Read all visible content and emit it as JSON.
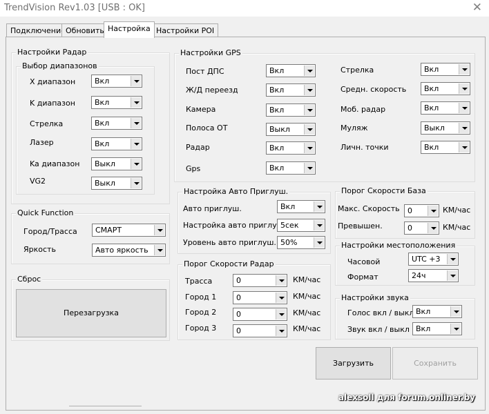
{
  "window": {
    "title": "TrendVision Rev1.03 [USB : OK]",
    "close_glyph": "✕"
  },
  "tabs": [
    {
      "label": "Подключение"
    },
    {
      "label": "Обновить"
    },
    {
      "label": "Настройка"
    },
    {
      "label": "Настройки POI"
    }
  ],
  "radar": {
    "legend": "Настройки Радар",
    "bands_legend": "Выбор диапазонов",
    "items": [
      {
        "label": "X диапазон",
        "value": "Вкл"
      },
      {
        "label": "K диапазон",
        "value": "Вкл"
      },
      {
        "label": "Стрелка",
        "value": "Вкл"
      },
      {
        "label": "Лазер",
        "value": "Вкл"
      },
      {
        "label": "Ka диапазон",
        "value": "Выкл"
      },
      {
        "label": "VG2",
        "value": "Выкл"
      }
    ]
  },
  "gps": {
    "legend": "Настройки GPS",
    "left": [
      {
        "label": "Пост ДПС",
        "value": "Вкл"
      },
      {
        "label": "Ж/Д переезд",
        "value": "Вкл"
      },
      {
        "label": "Камера",
        "value": "Вкл"
      },
      {
        "label": "Полоса ОТ",
        "value": "Выкл"
      },
      {
        "label": "Радар",
        "value": "Вкл"
      },
      {
        "label": "Gps",
        "value": "Вкл"
      }
    ],
    "right": [
      {
        "label": "Стрелка",
        "value": "Вкл"
      },
      {
        "label": "Средн. скорость",
        "value": "Вкл"
      },
      {
        "label": "Моб. радар",
        "value": "Вкл"
      },
      {
        "label": "Муляж",
        "value": "Выкл"
      },
      {
        "label": "Личн. точки",
        "value": "Вкл"
      }
    ]
  },
  "quick": {
    "legend": "Quick Function",
    "items": [
      {
        "label": "Город/Трасса",
        "value": "СМАРТ"
      },
      {
        "label": "Яркость",
        "value": "Авто яркость"
      }
    ]
  },
  "reset": {
    "legend": "Сброс",
    "button": "Перезагрузка"
  },
  "automute": {
    "legend": "Настройка Авто Приглуш.",
    "items": [
      {
        "label": "Авто приглуш.",
        "value": "Вкл"
      },
      {
        "label": "Настройка авто приглуш.",
        "value": "5сек"
      },
      {
        "label": "Уровень авто приглуш.",
        "value": "50%"
      }
    ]
  },
  "speed_radar": {
    "legend": "Порог Скорости Радар",
    "unit": "КМ/час",
    "items": [
      {
        "label": "Трасса",
        "value": "0"
      },
      {
        "label": "Город 1",
        "value": "0"
      },
      {
        "label": "Город 2",
        "value": "0"
      },
      {
        "label": "Город 3",
        "value": "0"
      }
    ]
  },
  "speed_base": {
    "legend": "Порог Скорости База",
    "unit": "КМ/час",
    "items": [
      {
        "label": "Макс. Скорость",
        "value": "0"
      },
      {
        "label": "Превышен.",
        "value": "0"
      }
    ]
  },
  "location": {
    "legend": "Настройки местоположения",
    "items": [
      {
        "label": "Часовой",
        "value": "UTC +3"
      },
      {
        "label": "Формат",
        "value": "24ч"
      }
    ]
  },
  "sound": {
    "legend": "Настройки звука",
    "items": [
      {
        "label": "Голос вкл / выкл",
        "value": "Вкл"
      },
      {
        "label": "Звук вкл / выкл",
        "value": "Вкл"
      }
    ]
  },
  "actions": {
    "load": "Загрузить",
    "save": "Сохранить"
  },
  "watermark": "alexsoll для forum.onliner.by"
}
